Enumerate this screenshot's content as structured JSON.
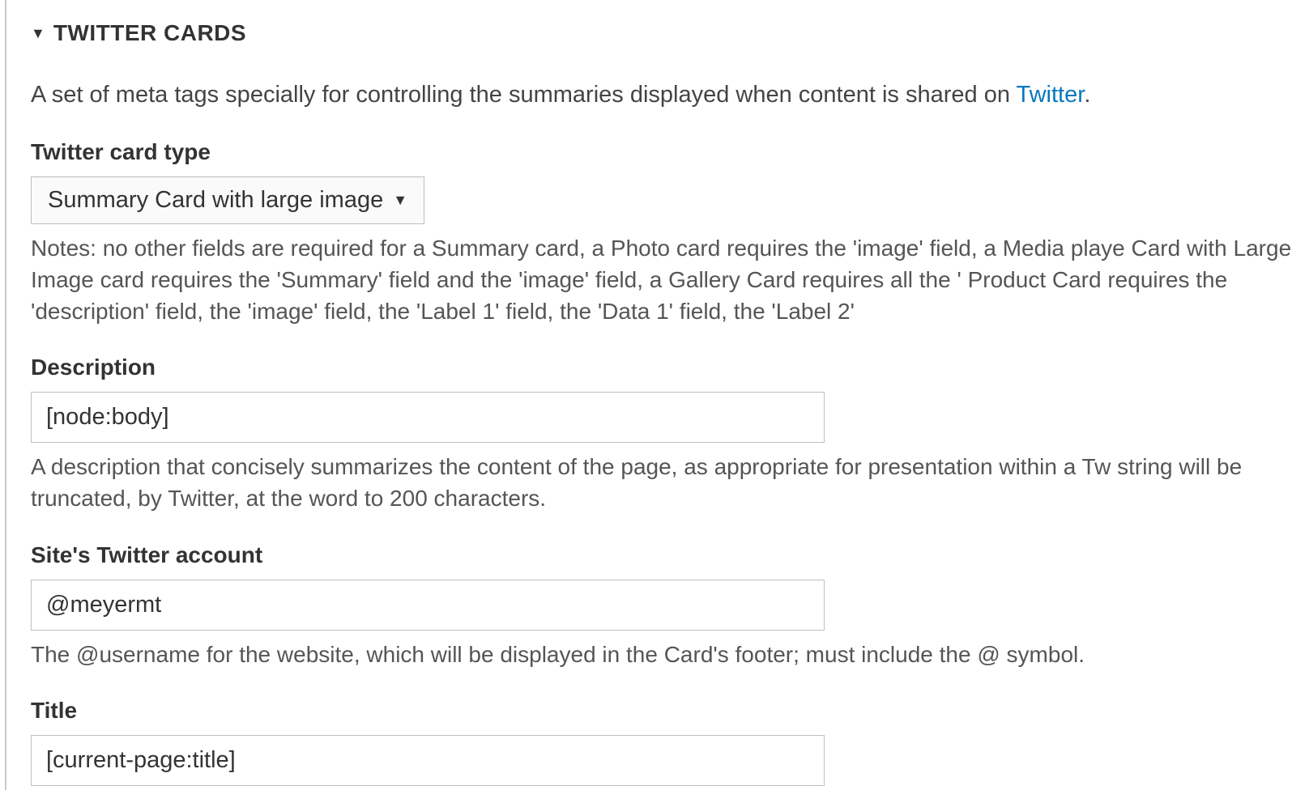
{
  "fieldset": {
    "title": "TWITTER CARDS",
    "intro_prefix": "A set of meta tags specially for controlling the summaries displayed when content is shared on ",
    "intro_link": "Twitter",
    "intro_suffix": "."
  },
  "card_type": {
    "label": "Twitter card type",
    "selected": "Summary Card with large image",
    "notes": "Notes: no other fields are required for a Summary card, a Photo card requires the 'image' field, a Media playe Card with Large Image card requires the 'Summary' field and the 'image' field, a Gallery Card requires all the ' Product Card requires the 'description' field, the 'image' field, the 'Label 1' field, the 'Data 1' field, the 'Label 2'"
  },
  "description": {
    "label": "Description",
    "value": "[node:body]",
    "help": "A description that concisely summarizes the content of the page, as appropriate for presentation within a Tw string will be truncated, by Twitter, at the word to 200 characters."
  },
  "site_account": {
    "label": "Site's Twitter account",
    "value": "@meyermt",
    "help": "The @username for the website, which will be displayed in the Card's footer; must include the @ symbol."
  },
  "title_field": {
    "label": "Title",
    "value": "[current-page:title]"
  }
}
